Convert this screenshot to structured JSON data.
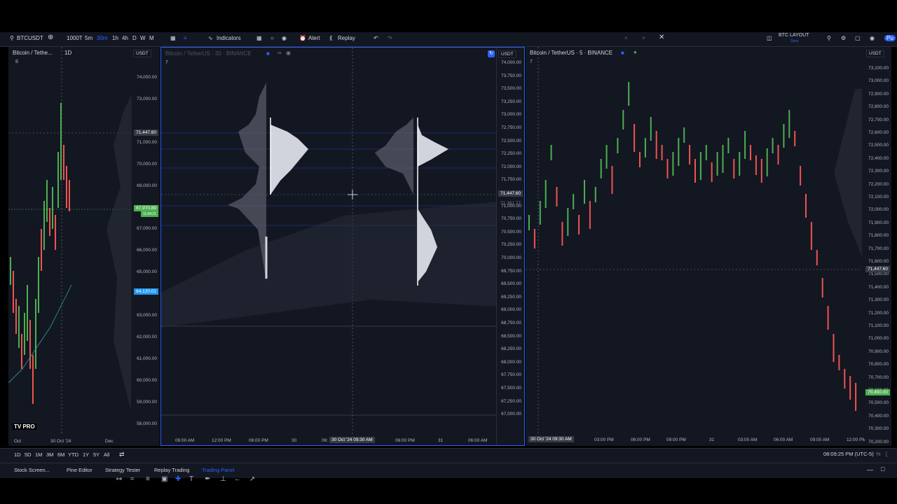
{
  "toolbar": {
    "symbol": "BTCUSDT",
    "intervals": [
      "1000T",
      "5m",
      "30m",
      "1h",
      "4h",
      "D",
      "W",
      "M"
    ],
    "indicators": "Indicators",
    "alert": "Alert",
    "replay": "Replay",
    "layout": "BTC LAYOUT",
    "layout_sub": "Save",
    "publish": "Pu"
  },
  "pane1": {
    "title": "Bitcoin / Tethe...",
    "interval": "1D",
    "collapse": "8",
    "currency": "USDT",
    "y_labels": [
      "74,000.00",
      "73,000.00",
      "71,000.00",
      "70,000.00",
      "69,000.00",
      "67,000.00",
      "66,000.00",
      "65,000.00",
      "63,000.00",
      "62,000.00",
      "61,000.00",
      "60,000.00",
      "59,000.00",
      "58,000.00"
    ],
    "crosshair_price": "71,447.60",
    "green_tag": "67,970.89",
    "green_tag2": "11:04:21",
    "blue_tag": "64,120.01",
    "x_labels": [
      "Oct",
      "30 Oct '24",
      "Dec"
    ],
    "logo": "TV PRO"
  },
  "pane2": {
    "title": "Bitcoin / TetherUS · 30 · BINANCE",
    "collapse": "7",
    "currency": "USDT",
    "y_labels": [
      "74,000.00",
      "73,750.00",
      "73,500.00",
      "73,250.00",
      "73,000.00",
      "72,750.00",
      "72,500.00",
      "72,250.00",
      "72,000.00",
      "71,750.00",
      "71,250.00",
      "71,000.00",
      "70,750.00",
      "70,500.00",
      "70,250.00",
      "70,000.00",
      "69,750.00",
      "69,500.00",
      "69,250.00",
      "69,000.00",
      "68,750.00",
      "68,500.00",
      "68,250.00",
      "68,000.00",
      "67,750.00",
      "67,500.00",
      "67,250.00",
      "67,000.00"
    ],
    "crosshair_price": "71,447.60",
    "crosshair_price2": "71,361.77",
    "x_labels": [
      "06:00 AM",
      "12:00 PM",
      "06:00 PM",
      "30",
      "06:",
      "06:00 PM",
      "31",
      "06:00 AM"
    ],
    "x_current": "30 Oct '24   09:30 AM"
  },
  "pane3": {
    "title": "Bitcoin / TetherUS · 5 · BINANCE",
    "collapse": "7",
    "currency": "USDT",
    "y_labels": [
      "73,100.00",
      "73,000.00",
      "72,900.00",
      "72,800.00",
      "72,700.00",
      "72,600.00",
      "72,500.00",
      "72,400.00",
      "72,300.00",
      "72,200.00",
      "72,100.00",
      "72,000.00",
      "71,900.00",
      "71,800.00",
      "71,700.00",
      "71,600.00",
      "71,500.00",
      "71,400.00",
      "71,300.00",
      "71,200.00",
      "71,100.00",
      "71,000.00",
      "70,900.00",
      "70,800.00",
      "70,700.00",
      "70,600.00",
      "70,500.00",
      "70,400.00",
      "70,300.00",
      "70,200.00"
    ],
    "crosshair_price": "71,447.60",
    "green_tag": "70,450.00",
    "x_labels": [
      "03:00 PM",
      "06:00 PM",
      "09:00 PM",
      "31",
      "03:00 AM",
      "06:00 AM",
      "09:00 AM",
      "12:00 PM"
    ],
    "x_current": "30 Oct '24   09:30 AM"
  },
  "timeframes": [
    "1D",
    "5D",
    "1M",
    "3M",
    "6M",
    "YTD",
    "1Y",
    "5Y",
    "All"
  ],
  "clock": "08:09:25 PM (UTC-5)",
  "bottom_tabs": [
    "Stock Screen...",
    "Pine Editor",
    "Strategy Tester",
    "Replay Trading",
    "Trading Panel"
  ],
  "colors": {
    "bg": "#131722",
    "up": "#26a69a",
    "green": "#4caf50",
    "red": "#ef5350",
    "accent": "#2962ff"
  }
}
